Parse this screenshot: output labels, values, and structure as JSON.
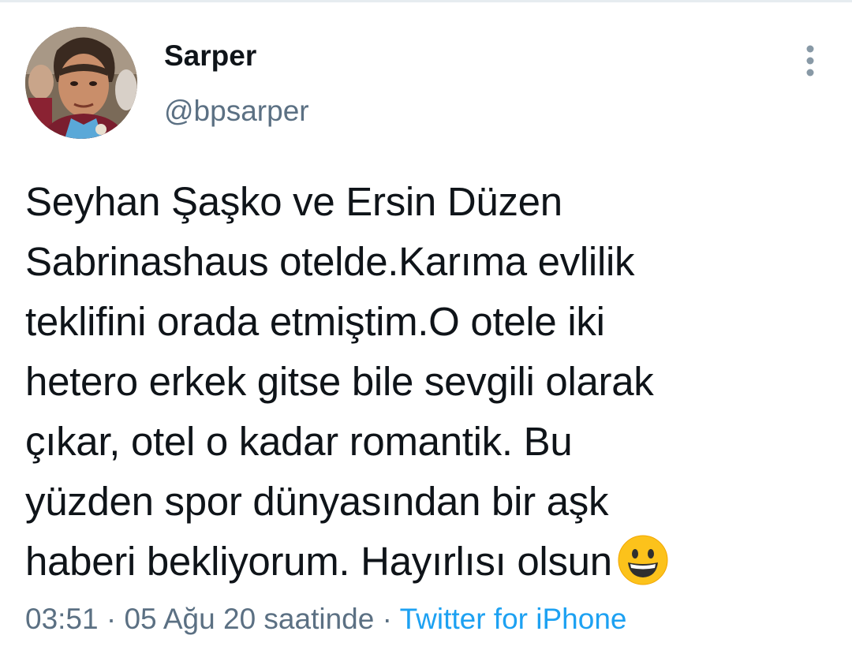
{
  "tweet": {
    "author": {
      "display_name": "Sarper",
      "handle": "@bpsarper",
      "avatar_icon": "profile-photo"
    },
    "more_icon": "more-vertical-icon",
    "text_lines": [
      "Seyhan Şaşko ve Ersin Düzen",
      "Sabrinashaus otelde.Karıma evlilik",
      "teklifini orada etmiştim.O otele iki",
      "hetero erkek gitse bile sevgili olarak",
      "çıkar, otel o kadar romantik. Bu",
      "yüzden spor dünyasından bir aşk",
      "haberi bekliyorum. Hayırlısı olsun"
    ],
    "emoji": "grinning-face-icon",
    "time": "03:51",
    "separator": "·",
    "date": "05 Ağu 20 saatinde",
    "source": "Twitter for iPhone"
  },
  "colors": {
    "text_primary": "#0f1419",
    "text_secondary": "#5b7083",
    "link": "#1da1f2",
    "divider": "#e6ecf0",
    "emoji_face": "#fcc21b"
  }
}
